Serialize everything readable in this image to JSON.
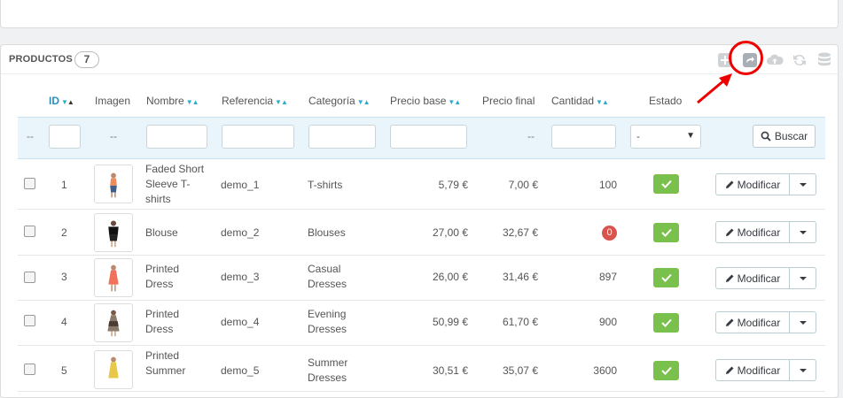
{
  "panel": {
    "title": "PRODUCTOS",
    "count": "7"
  },
  "toolbar": {
    "icons": [
      "add-icon",
      "export-icon",
      "upload-cloud-icon",
      "refresh-icon",
      "database-icon"
    ]
  },
  "table": {
    "headers": {
      "id": "ID",
      "image": "Imagen",
      "name": "Nombre",
      "reference": "Referencia",
      "category": "Categoría",
      "base_price": "Precio base",
      "final_price": "Precio final",
      "quantity": "Cantidad",
      "status": "Estado"
    },
    "filters": {
      "dash": "--",
      "status_select_value": "-",
      "search_label": "Buscar"
    },
    "rows": [
      {
        "id": "1",
        "name": "Faded Short Sleeve T-shirts",
        "name_lines": [
          "Faded Short",
          "Sleeve T-",
          "shirts"
        ],
        "reference": "demo_1",
        "category": "T-shirts",
        "category_lines": [
          "T-shirts"
        ],
        "base_price": "5,79 €",
        "final_price": "7,00 €",
        "quantity": "100",
        "status": "enabled",
        "edit_label": "Modificar"
      },
      {
        "id": "2",
        "name": "Blouse",
        "name_lines": [
          "Blouse"
        ],
        "reference": "demo_2",
        "category": "Blouses",
        "category_lines": [
          "Blouses"
        ],
        "base_price": "27,00 €",
        "final_price": "32,67 €",
        "quantity": "0",
        "status": "enabled",
        "edit_label": "Modificar"
      },
      {
        "id": "3",
        "name": "Printed Dress",
        "name_lines": [
          "Printed",
          "Dress"
        ],
        "reference": "demo_3",
        "category": "Casual Dresses",
        "category_lines": [
          "Casual",
          "Dresses"
        ],
        "base_price": "26,00 €",
        "final_price": "31,46 €",
        "quantity": "897",
        "status": "enabled",
        "edit_label": "Modificar"
      },
      {
        "id": "4",
        "name": "Printed Dress",
        "name_lines": [
          "Printed",
          "Dress"
        ],
        "reference": "demo_4",
        "category": "Evening Dresses",
        "category_lines": [
          "Evening",
          "Dresses"
        ],
        "base_price": "50,99 €",
        "final_price": "61,70 €",
        "quantity": "900",
        "status": "enabled",
        "edit_label": "Modificar"
      },
      {
        "id": "5",
        "name": "Printed Summer",
        "name_lines": [
          "Printed",
          "Summer"
        ],
        "reference": "demo_5",
        "category": "Summer Dresses",
        "category_lines": [
          "Summer",
          "Dresses"
        ],
        "base_price": "30,51 €",
        "final_price": "35,07 €",
        "quantity": "3600",
        "status": "enabled",
        "edit_label": "Modificar"
      }
    ]
  },
  "colors": {
    "accent": "#2eacce",
    "status_on": "#79c14c",
    "zero_badge": "#d9534f",
    "annotation": "#e00000",
    "filter_bg": "#eaf5fb"
  }
}
